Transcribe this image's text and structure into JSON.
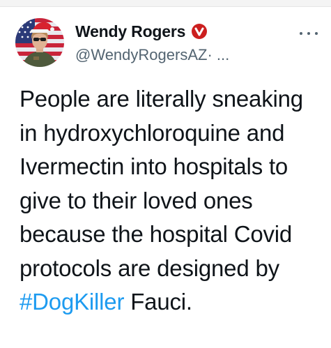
{
  "author": {
    "display_name": "Wendy Rogers",
    "handle": "@WendyRogersAZ",
    "handle_suffix": " · ...",
    "badge_icon": "verified-badge-icon",
    "badge_color": "#cc1f1f"
  },
  "tweet": {
    "text_before": "People are literally sneaking in hydroxychloroquine and Ivermectin into hospitals to give to their loved ones because the hospital Covid protocols are designed by ",
    "hashtag": "#DogKiller",
    "text_after": " Fauci.",
    "hashtag_color": "#1d9bf0"
  },
  "menu": {
    "icon": "more-options-icon"
  }
}
